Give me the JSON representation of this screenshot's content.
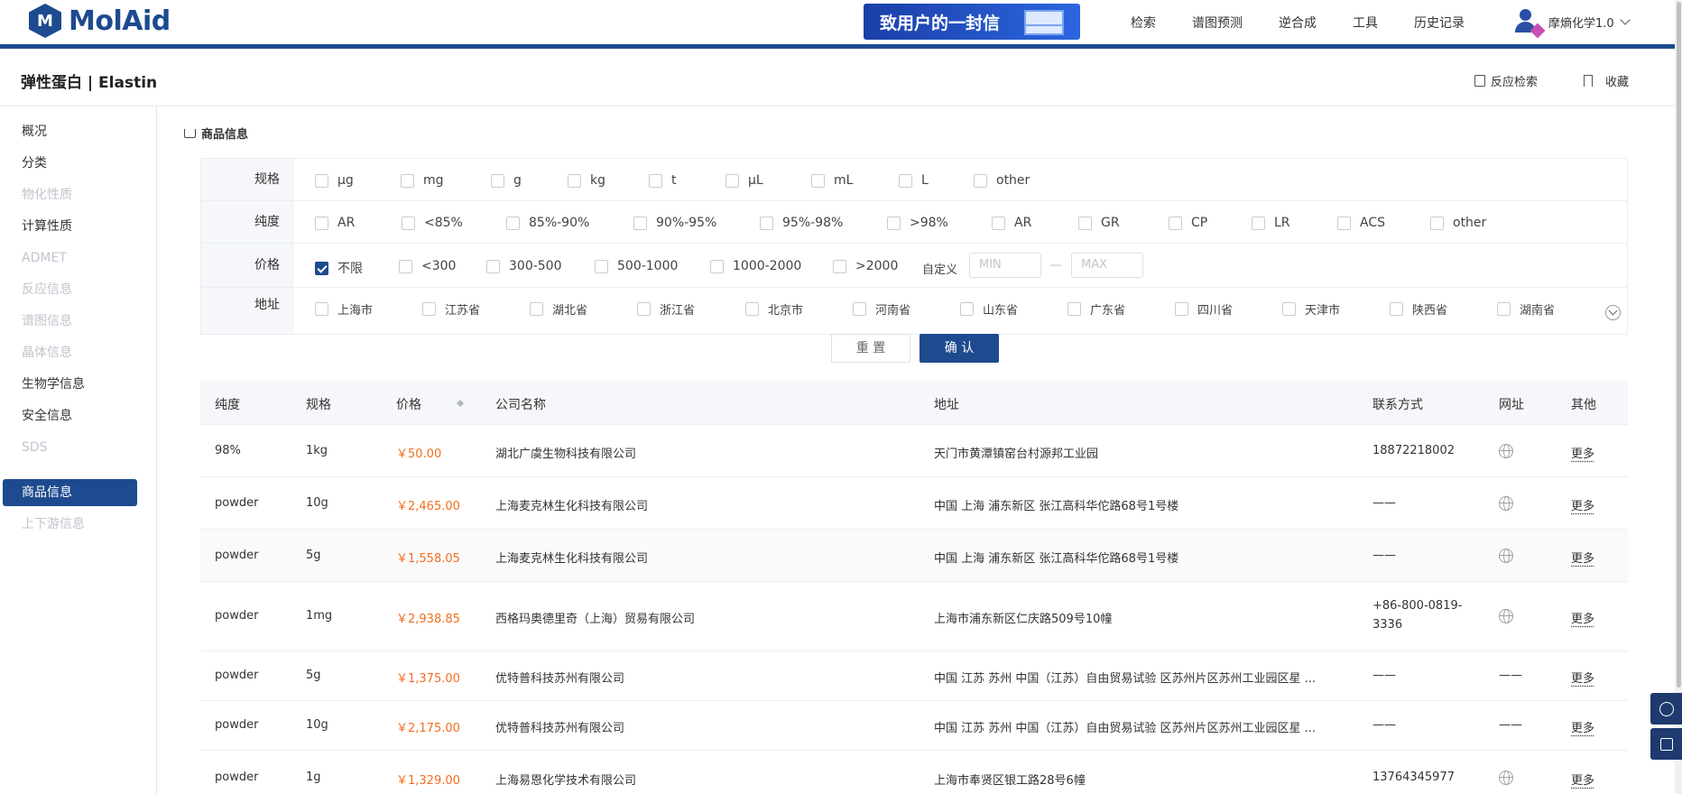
{
  "header": {
    "logo_text": "MolAid",
    "banner_text": "致用户的一封信",
    "nav": [
      "检索",
      "谱图预测",
      "逆合成",
      "工具",
      "历史记录"
    ],
    "user_name": "摩熵化学1.0"
  },
  "subheader": {
    "title": "弹性蛋白 | Elastin",
    "reaction_search": "反应检索",
    "favorite": "收藏"
  },
  "sidebar": {
    "items": [
      {
        "label": "概况",
        "state": "normal"
      },
      {
        "label": "分类",
        "state": "normal"
      },
      {
        "label": "物化性质",
        "state": "disabled"
      },
      {
        "label": "计算性质",
        "state": "normal"
      },
      {
        "label": "ADMET",
        "state": "disabled"
      },
      {
        "label": "反应信息",
        "state": "disabled"
      },
      {
        "label": "谱图信息",
        "state": "disabled"
      },
      {
        "label": "晶体信息",
        "state": "disabled"
      },
      {
        "label": "生物学信息",
        "state": "normal"
      },
      {
        "label": "安全信息",
        "state": "normal"
      },
      {
        "label": "SDS",
        "state": "disabled"
      },
      {
        "label": "商品信息",
        "state": "active"
      },
      {
        "label": "上下游信息",
        "state": "disabled"
      }
    ]
  },
  "section_title": "商品信息",
  "filters": {
    "spec": {
      "label": "规格",
      "options": [
        "μg",
        "mg",
        "g",
        "kg",
        "t",
        "μL",
        "mL",
        "L",
        "other"
      ]
    },
    "purity": {
      "label": "纯度",
      "options": [
        "AR",
        "<85%",
        "85%-90%",
        "90%-95%",
        "95%-98%",
        ">98%",
        "AR",
        "GR",
        "CP",
        "LR",
        "ACS",
        "other"
      ]
    },
    "price": {
      "label": "价格",
      "options": [
        "不限",
        "<300",
        "300-500",
        "500-1000",
        "1000-2000",
        ">2000"
      ],
      "checked": "不限",
      "custom_label": "自定义",
      "min_placeholder": "MIN",
      "max_placeholder": "MAX",
      "dash": "—"
    },
    "address": {
      "label": "地址",
      "options": [
        "上海市",
        "江苏省",
        "湖北省",
        "浙江省",
        "北京市",
        "河南省",
        "山东省",
        "广东省",
        "四川省",
        "天津市",
        "陕西省",
        "湖南省"
      ]
    }
  },
  "buttons": {
    "reset": "重 置",
    "confirm": "确 认"
  },
  "table": {
    "headers": [
      "纯度",
      "规格",
      "价格",
      "公司名称",
      "地址",
      "联系方式",
      "网址",
      "其他"
    ],
    "rows": [
      {
        "purity": "98%",
        "spec": "1kg",
        "price": "￥50.00",
        "company": "湖北广虞生物科技有限公司",
        "address": "天门市黄潭镇窑台村源邦工业园",
        "contact": "18872218002",
        "contact2": "",
        "web": "globe",
        "more": "更多"
      },
      {
        "purity": "powder",
        "spec": "10g",
        "price": "￥2,465.00",
        "company": "上海麦克林生化科技有限公司",
        "address": "中国 上海 浦东新区 张江高科华佗路68号1号楼",
        "contact": "——",
        "contact2": "",
        "web": "globe",
        "more": "更多"
      },
      {
        "purity": "powder",
        "spec": "5g",
        "price": "￥1,558.05",
        "company": "上海麦克林生化科技有限公司",
        "address": "中国 上海 浦东新区 张江高科华佗路68号1号楼",
        "contact": "——",
        "contact2": "",
        "web": "globe",
        "more": "更多"
      },
      {
        "purity": "powder",
        "spec": "1mg",
        "price": "￥2,938.85",
        "company": "西格玛奥德里奇（上海）贸易有限公司",
        "address": "上海市浦东新区仁庆路509号10幢",
        "contact": "+86-800-0819-",
        "contact2": "3336",
        "web": "globe",
        "more": "更多"
      },
      {
        "purity": "powder",
        "spec": "5g",
        "price": "￥1,375.00",
        "company": "优特普科技苏州有限公司",
        "address": "中国 江苏 苏州 中国（江苏）自由贸易试验 区苏州片区苏州工业园区星 ...",
        "contact": "——",
        "contact2": "",
        "web": "——",
        "more": "更多"
      },
      {
        "purity": "powder",
        "spec": "10g",
        "price": "￥2,175.00",
        "company": "优特普科技苏州有限公司",
        "address": "中国 江苏 苏州 中国（江苏）自由贸易试验 区苏州片区苏州工业园区星 ...",
        "contact": "——",
        "contact2": "",
        "web": "——",
        "more": "更多"
      },
      {
        "purity": "powder",
        "spec": "1g",
        "price": "￥1,329.00",
        "company": "上海易恩化学技术有限公司",
        "address": "上海市奉贤区银工路28号6幢",
        "contact": "13764345977",
        "contact2": "",
        "web": "globe",
        "more": "更多"
      }
    ]
  },
  "colors": {
    "primary": "#1e4b8f",
    "price": "#f56c1c"
  }
}
